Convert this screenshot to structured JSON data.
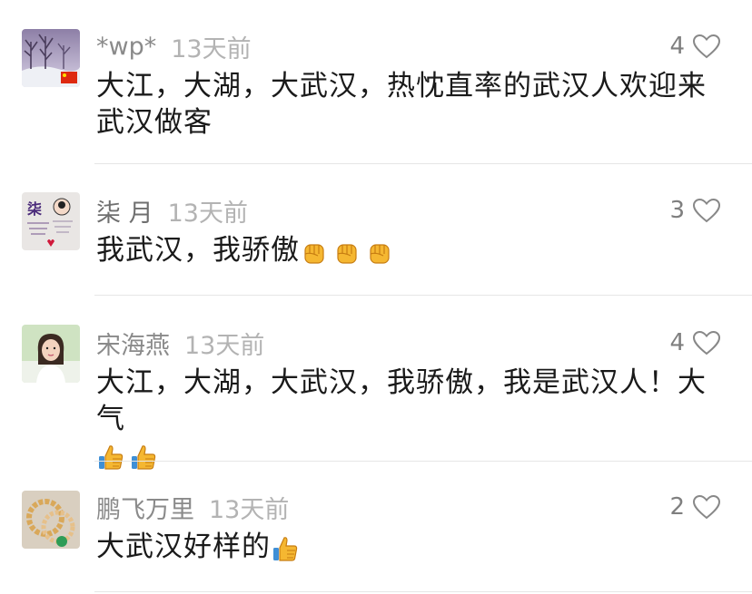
{
  "comments": [
    {
      "username": "*wp*",
      "time": "13天前",
      "likes": "4",
      "text": "大江，大湖，大武汉，热忱直率的武汉人欢迎来武汉做客",
      "avatar": "winter-trees-avatar",
      "emojis": []
    },
    {
      "username": "柒 月",
      "time": "13天前",
      "likes": "3",
      "text": "我武汉，我骄傲",
      "avatar": "calligraphy-avatar",
      "emojis": [
        "raised-fist-icon",
        "raised-fist-icon",
        "raised-fist-icon"
      ]
    },
    {
      "username": "宋海燕",
      "time": "13天前",
      "likes": "4",
      "text": "大江，大湖，大武汉，我骄傲，我是武汉人！大气",
      "avatar": "woman-portrait-avatar",
      "emojis": [
        "thumbs-up-icon",
        "thumbs-up-icon"
      ]
    },
    {
      "username": "鹏飞万里",
      "time": "13天前",
      "likes": "2",
      "text": "大武汉好样的",
      "avatar": "bracelet-avatar",
      "emojis": [
        "thumbs-up-icon"
      ]
    }
  ],
  "colors": {
    "username": "#8a8a8a",
    "time": "#b3b3b3",
    "text": "#1a1a1a",
    "divider": "#e6e6e6",
    "emoji_yellow": "#f5b731"
  }
}
